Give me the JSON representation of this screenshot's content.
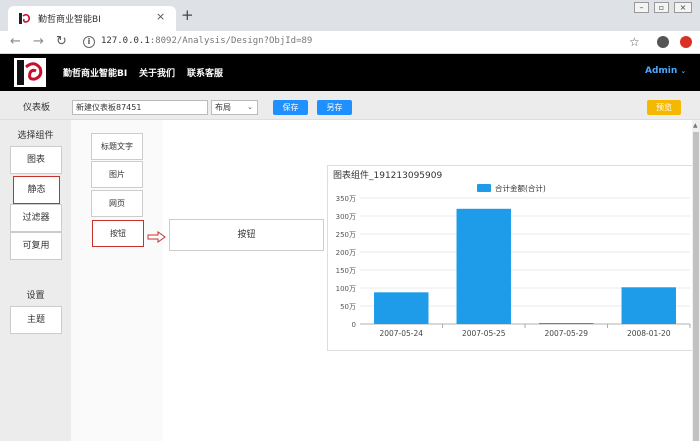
{
  "browser": {
    "tab_title": "勤哲商业智能BI",
    "url_host": "127.0.0.1",
    "url_rest": ":8092/Analysis/Design?ObjId=89",
    "new_tab": "+",
    "close": "×"
  },
  "header": {
    "brand": "勤哲商业智能BI",
    "nav": [
      "关于我们",
      "联系客服"
    ],
    "user": "Admin"
  },
  "dashbar": {
    "label": "仪表板",
    "name_value": "新建仪表板87451",
    "layout_label": "布局",
    "save_label": "保存",
    "save_as_label": "另存",
    "preview_label": "预览"
  },
  "sidebar": {
    "title": "选择组件",
    "items": [
      {
        "label": "图表"
      },
      {
        "label": "静态"
      },
      {
        "label": "过滤器"
      },
      {
        "label": "可复用"
      }
    ],
    "settings_title": "设置",
    "theme_label": "主题"
  },
  "components": [
    {
      "label": "标题文字"
    },
    {
      "label": "图片"
    },
    {
      "label": "网页"
    },
    {
      "label": "按钮"
    }
  ],
  "canvas": {
    "button_widget_label": "按钮",
    "chart_panel_title": "图表组件_191213095909"
  },
  "colors": {
    "accent": "#1e90ff",
    "preview": "#f5b800",
    "active_border": "#c9302c",
    "bar": "#1e9be9"
  },
  "chart_data": {
    "type": "bar",
    "categories": [
      "2007-05-24",
      "2007-05-25",
      "2007-05-29",
      "2008-01-20"
    ],
    "series": [
      {
        "name": "合计金额(合计)",
        "values": [
          880000,
          3200000,
          0,
          1020000
        ]
      }
    ],
    "ylim": [
      0,
      3500000
    ],
    "y_ticks": [
      {
        "value": 0,
        "label": "0"
      },
      {
        "value": 500000,
        "label": "50万"
      },
      {
        "value": 1000000,
        "label": "100万"
      },
      {
        "value": 1500000,
        "label": "150万"
      },
      {
        "value": 2000000,
        "label": "200万"
      },
      {
        "value": 2500000,
        "label": "250万"
      },
      {
        "value": 3000000,
        "label": "300万"
      },
      {
        "value": 3500000,
        "label": "350万"
      }
    ],
    "legend": "top-center",
    "grid": true
  }
}
